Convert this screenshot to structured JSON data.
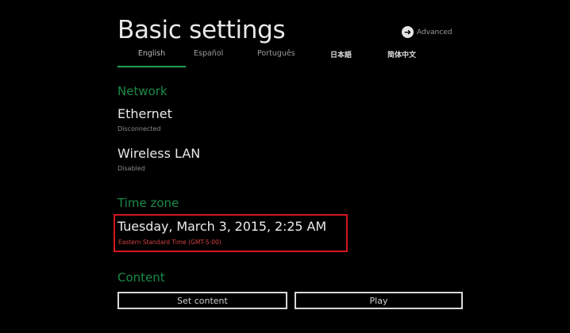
{
  "header": {
    "title": "Basic settings",
    "advanced_label": "Advanced",
    "advanced_icon": "arrow-right-circle-icon"
  },
  "languages": [
    {
      "label": "English",
      "active": true
    },
    {
      "label": "Español",
      "active": false
    },
    {
      "label": "Português",
      "active": false
    },
    {
      "label": "日本語",
      "active": false
    },
    {
      "label": "简体中文",
      "active": false
    }
  ],
  "network": {
    "section_title": "Network",
    "ethernet": {
      "title": "Ethernet",
      "status": "Disconnected"
    },
    "wireless": {
      "title": "Wireless LAN",
      "status": "Disabled"
    }
  },
  "timezone": {
    "section_title": "Time zone",
    "datetime": "Tuesday, March 3, 2015, 2:25 AM",
    "zone": "Eastern Standard Time (GMT-5:00)"
  },
  "content": {
    "section_title": "Content",
    "set_content_label": "Set content",
    "play_label": "Play"
  },
  "colors": {
    "accent": "#1fa356",
    "highlight": "#d4161f",
    "background": "#000000"
  }
}
